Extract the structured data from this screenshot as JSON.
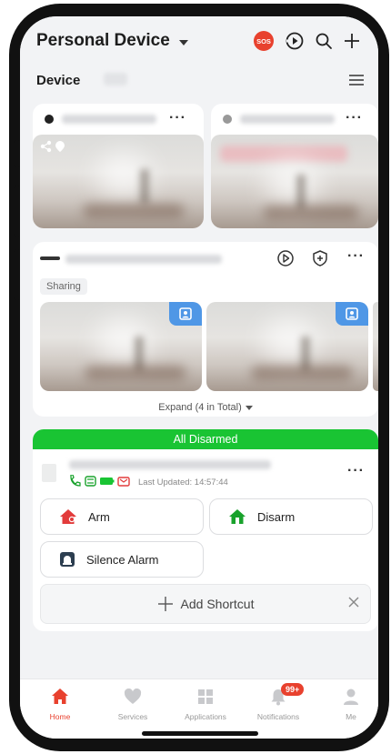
{
  "header": {
    "title": "Personal Device",
    "sos_label": "SOS",
    "section": "Device"
  },
  "sharing_card": {
    "sharing_label": "Sharing",
    "expand_label": "Expand (4 in Total)"
  },
  "alarm_card": {
    "status": "All Disarmed",
    "last_updated": "Last Updated: 14:57:44",
    "arm_label": "Arm",
    "disarm_label": "Disarm",
    "silence_label": "Silence Alarm",
    "add_shortcut_label": "Add Shortcut"
  },
  "nav": {
    "items": [
      {
        "label": "Home",
        "icon": "home-icon"
      },
      {
        "label": "Services",
        "icon": "heart-icon"
      },
      {
        "label": "Applications",
        "icon": "grid-icon"
      },
      {
        "label": "Notifications",
        "icon": "bell-icon"
      },
      {
        "label": "Me",
        "icon": "person-icon"
      }
    ],
    "notifications_badge": "99+"
  },
  "colors": {
    "accent": "#e8412e",
    "disarmed": "#19c433",
    "share_badge": "#4f97e6"
  }
}
